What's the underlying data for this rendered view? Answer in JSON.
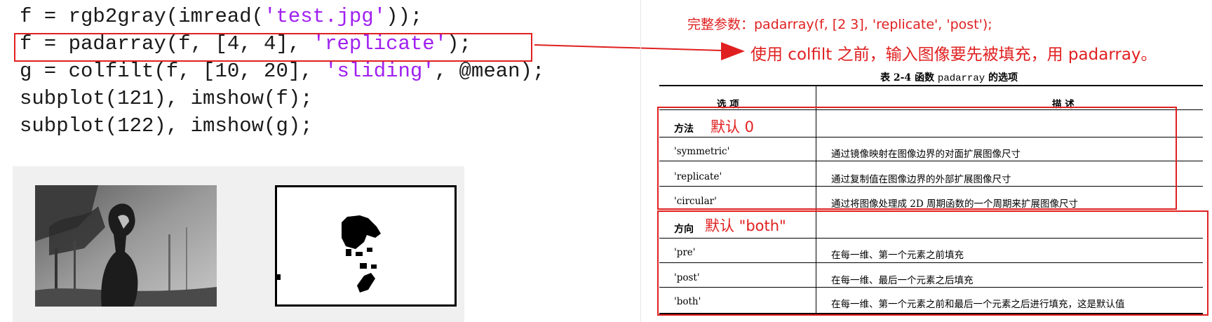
{
  "code": {
    "lines": [
      {
        "pre": "f = rgb2gray(imread(",
        "str": "'test.jpg'",
        "post": "));"
      },
      {
        "pre": "f = padarray(f, [4, 4], ",
        "str": "'replicate'",
        "post": ");"
      },
      {
        "pre": "g = colfilt(f, [10, 20], ",
        "str": "'sliding'",
        "post": ", @mean);"
      },
      {
        "pre": "subplot(121), imshow(f);",
        "str": "",
        "post": ""
      },
      {
        "pre": "subplot(122), imshow(g);",
        "str": "",
        "post": ""
      }
    ]
  },
  "notes": {
    "full_params": "完整参数：padarray(f, [2 3], 'replicate', 'post');",
    "explanation": "使用 colfilt 之前，输入图像要先被填充，用 padarray。"
  },
  "table": {
    "title_prefix": "表 2-4  函数 ",
    "title_func": "padarray",
    "title_suffix": " 的选项",
    "col_option": "选    项",
    "col_desc": "描    述",
    "method_label": "方法",
    "method_default": "默认 0",
    "method_rows": [
      {
        "option": "'symmetric'",
        "desc": "通过镜像映射在图像边界的对面扩展图像尺寸"
      },
      {
        "option": "'replicate'",
        "desc": "通过复制值在图像边界的外部扩展图像尺寸"
      },
      {
        "option": "'circular'",
        "desc": "通过将图像处理成 2D 周期函数的一个周期来扩展图像尺寸"
      }
    ],
    "direction_label": "方向",
    "direction_default": "默认 \"both\"",
    "direction_rows": [
      {
        "option": "'pre'",
        "desc": "在每一维、第一个元素之前填充"
      },
      {
        "option": "'post'",
        "desc": "在每一维、最后一个元素之后填充"
      },
      {
        "option": "'both'",
        "desc": "在每一维、第一个元素之前和最后一个元素之后进行填充，这是默认值"
      }
    ]
  },
  "colors": {
    "accent_red": "#e02020",
    "code_string": "#a020f0"
  }
}
